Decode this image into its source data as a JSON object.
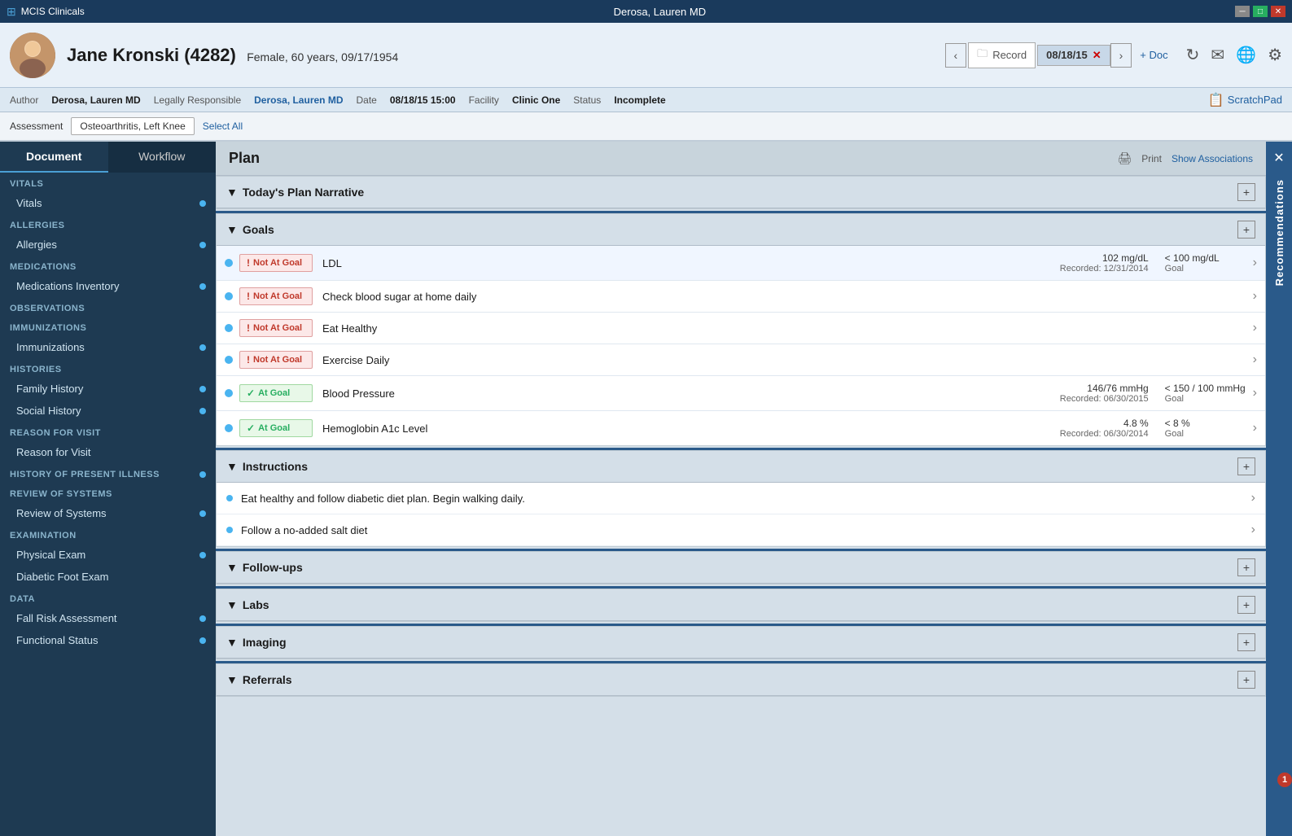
{
  "app": {
    "title": "MCIS Clinicals",
    "window_title": "Derosa, Lauren MD",
    "min_btn": "─",
    "max_btn": "□",
    "close_btn": "✕"
  },
  "header": {
    "patient_name": "Jane Kronski (4282)",
    "patient_demographics": "Female, 60 years,  09/17/1954",
    "record_label": "Record",
    "date_tab": "08/18/15",
    "add_doc": "+ Doc",
    "scratchpad": "ScratchPad"
  },
  "meta": {
    "author_label": "Author",
    "author_value": "Derosa, Lauren MD",
    "legal_label": "Legally Responsible",
    "legal_value": "Derosa, Lauren MD",
    "date_label": "Date",
    "date_value": "08/18/15 15:00",
    "facility_label": "Facility",
    "facility_value": "Clinic One",
    "status_label": "Status",
    "status_value": "Incomplete"
  },
  "assessment": {
    "label": "Assessment",
    "tag": "Osteoarthritis, Left Knee",
    "select_all": "Select All"
  },
  "sidebar": {
    "tabs": [
      {
        "label": "Document",
        "active": true
      },
      {
        "label": "Workflow",
        "active": false
      }
    ],
    "sections": [
      {
        "header": "VITALS",
        "items": [
          {
            "label": "Vitals",
            "dot": true
          }
        ]
      },
      {
        "header": "ALLERGIES",
        "items": [
          {
            "label": "Allergies",
            "dot": true
          }
        ]
      },
      {
        "header": "MEDICATIONS",
        "items": [
          {
            "label": "Medications Inventory",
            "dot": true
          }
        ]
      },
      {
        "header": "OBSERVATIONS",
        "items": []
      },
      {
        "header": "IMMUNIZATIONS",
        "items": [
          {
            "label": "Immunizations",
            "dot": true
          }
        ]
      },
      {
        "header": "HISTORIES",
        "items": [
          {
            "label": "Family History",
            "dot": true
          },
          {
            "label": "Social History",
            "dot": true
          }
        ]
      },
      {
        "header": "REASON FOR VISIT",
        "items": [
          {
            "label": "Reason for Visit",
            "dot": false
          }
        ]
      },
      {
        "header": "HISTORY OF PRESENT ILLNESS",
        "items": [],
        "dot": true
      },
      {
        "header": "REVIEW OF SYSTEMS",
        "items": [
          {
            "label": "Review of Systems",
            "dot": true
          }
        ]
      },
      {
        "header": "EXAMINATION",
        "items": [
          {
            "label": "Physical Exam",
            "dot": true
          },
          {
            "label": "Diabetic Foot Exam",
            "dot": false
          }
        ]
      },
      {
        "header": "DATA",
        "items": [
          {
            "label": "Fall Risk Assessment",
            "dot": true
          },
          {
            "label": "Functional Status",
            "dot": true
          }
        ]
      }
    ]
  },
  "plan": {
    "title": "Plan",
    "print": "Print",
    "show_associations": "Show Associations",
    "sections": [
      {
        "id": "plan-narrative",
        "title": "Today's Plan Narrative",
        "expanded": true,
        "has_add": true
      },
      {
        "id": "goals",
        "title": "Goals",
        "expanded": true,
        "has_add": true
      },
      {
        "id": "instructions",
        "title": "Instructions",
        "expanded": true,
        "has_add": true
      },
      {
        "id": "followups",
        "title": "Follow-ups",
        "expanded": true,
        "has_add": true
      },
      {
        "id": "labs",
        "title": "Labs",
        "expanded": true,
        "has_add": true
      },
      {
        "id": "imaging",
        "title": "Imaging",
        "expanded": true,
        "has_add": true
      },
      {
        "id": "referrals",
        "title": "Referrals",
        "expanded": true,
        "has_add": true
      }
    ],
    "goals": [
      {
        "status": "not-at-goal",
        "status_label": "Not At Goal",
        "name": "LDL",
        "value": "102 mg/dL",
        "recorded": "Recorded: 12/31/2014",
        "target": "< 100 mg/dL",
        "target_label": "Goal"
      },
      {
        "status": "not-at-goal",
        "status_label": "Not At Goal",
        "name": "Check blood sugar at home daily",
        "value": "",
        "recorded": "",
        "target": "",
        "target_label": ""
      },
      {
        "status": "not-at-goal",
        "status_label": "Not At Goal",
        "name": "Eat Healthy",
        "value": "",
        "recorded": "",
        "target": "",
        "target_label": ""
      },
      {
        "status": "not-at-goal",
        "status_label": "Not At Goal",
        "name": "Exercise Daily",
        "value": "",
        "recorded": "",
        "target": "",
        "target_label": ""
      },
      {
        "status": "at-goal",
        "status_label": "At Goal",
        "name": "Blood Pressure",
        "value": "146/76 mmHg",
        "recorded": "Recorded: 06/30/2015",
        "target": "< 150 / 100 mmHg",
        "target_label": "Goal"
      },
      {
        "status": "at-goal",
        "status_label": "At Goal",
        "name": "Hemoglobin A1c Level",
        "value": "4.8 %",
        "recorded": "Recorded: 06/30/2014",
        "target": "< 8 %",
        "target_label": "Goal"
      }
    ],
    "instructions": [
      {
        "text": "Eat healthy and follow diabetic diet plan.  Begin walking daily."
      },
      {
        "text": "Follow a no-added salt diet"
      }
    ]
  },
  "right_sidebar": {
    "label": "Recommendations",
    "badge": "1"
  }
}
